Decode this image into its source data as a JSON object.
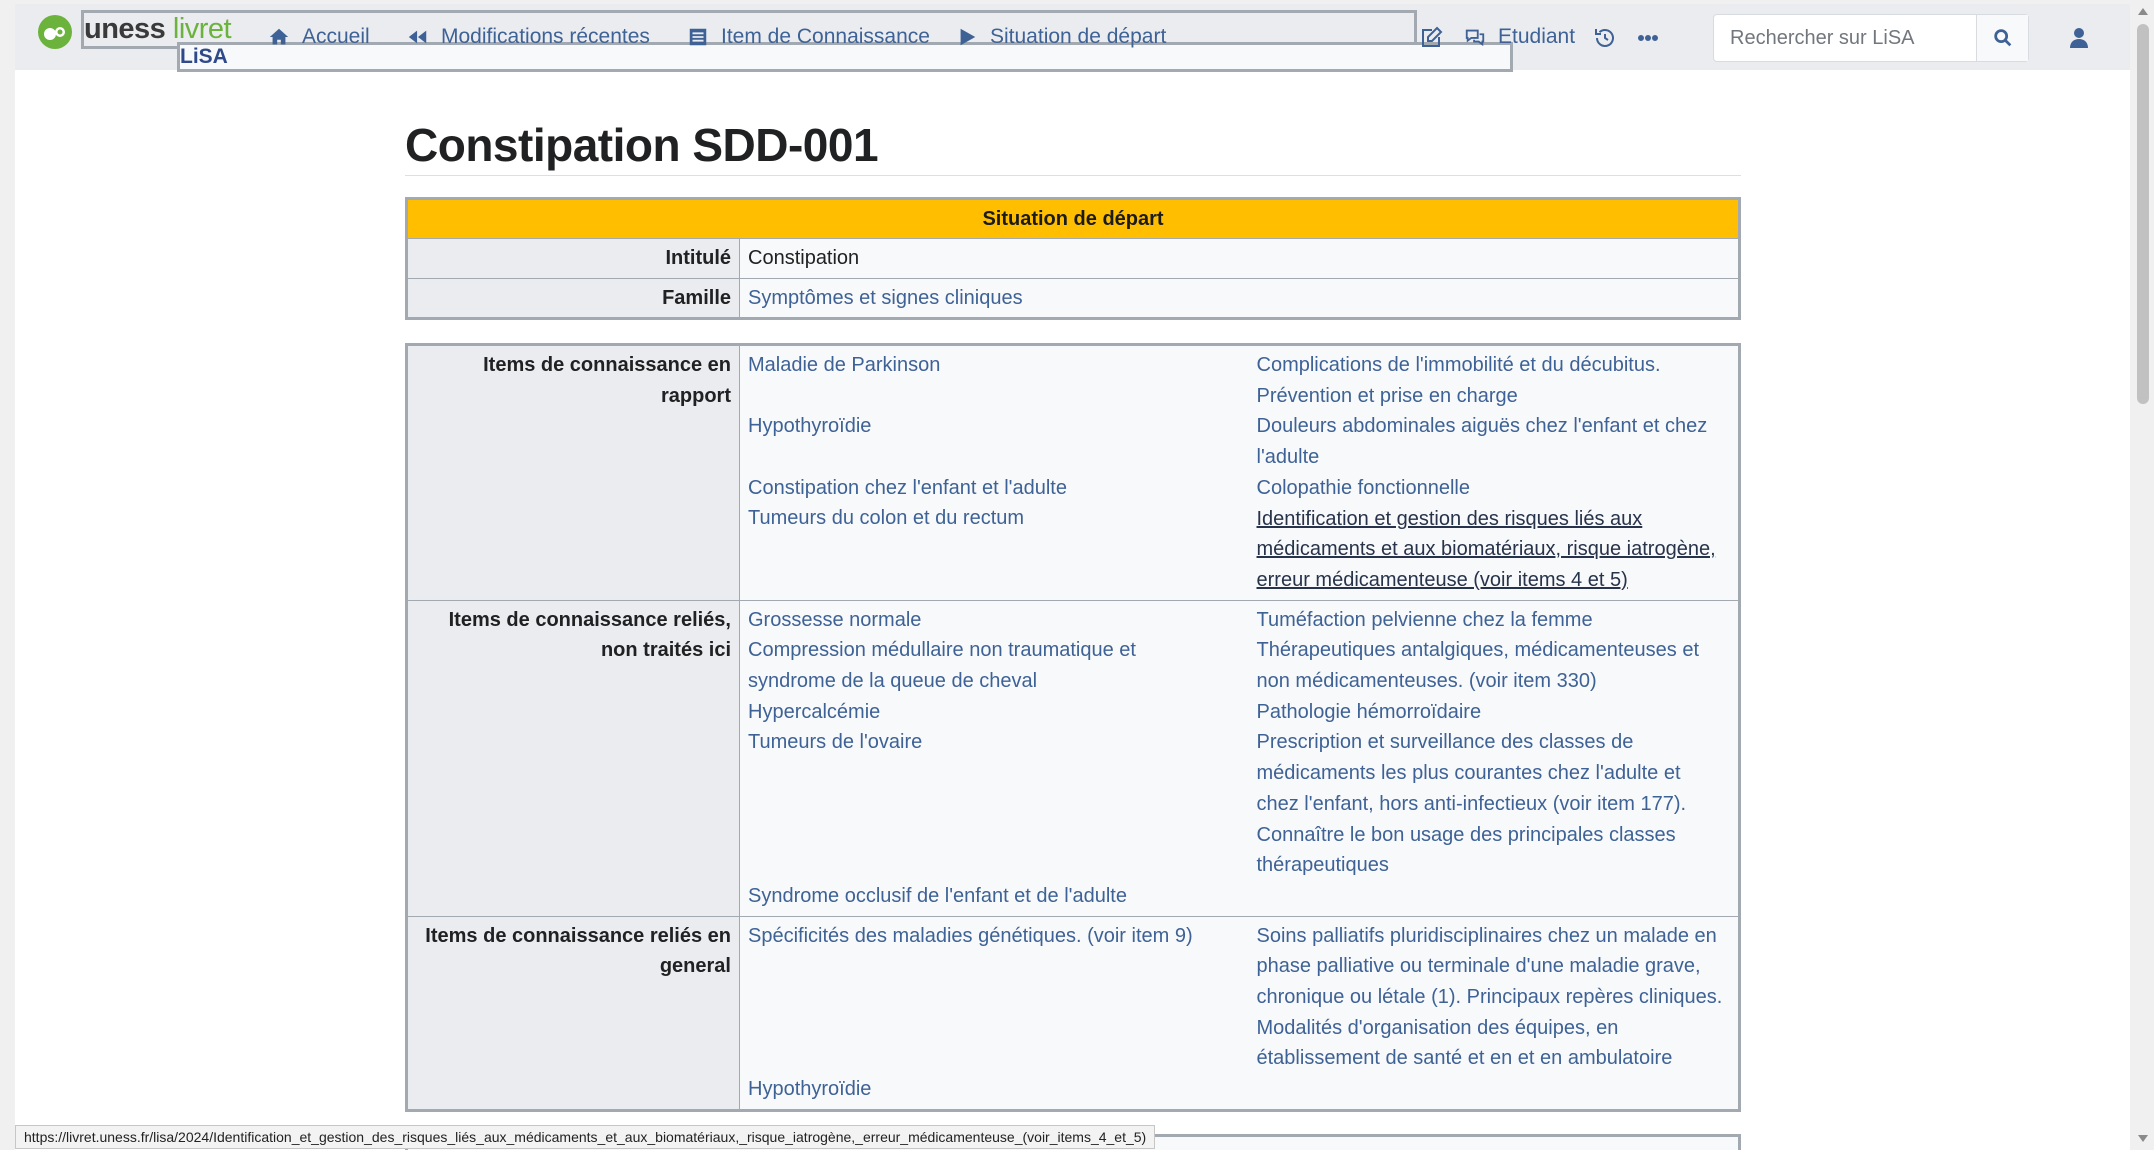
{
  "app": {
    "logo_main": "uness",
    "logo_green": "livret",
    "logo_sub": "LiSA"
  },
  "nav": {
    "home": "Accueil",
    "recent": "Modifications récentes",
    "item": "Item de Connaissance",
    "situation": "Situation de départ",
    "user_role": "Etudiant"
  },
  "search": {
    "placeholder": "Rechercher sur LiSA"
  },
  "page": {
    "title": "Constipation SDD-001"
  },
  "summary_table": {
    "header": "Situation de départ",
    "rows": [
      {
        "label": "Intitulé",
        "value": "Constipation"
      },
      {
        "label": "Famille",
        "value": "Symptômes et signes cliniques"
      }
    ]
  },
  "items_table": {
    "sections": [
      {
        "label_l1": "Items de connaissance en",
        "label_l2": "rapport",
        "left": [
          "Maladie de Parkinson",
          "",
          "Hypothyroïdie",
          "",
          "Constipation chez l'enfant et l'adulte",
          "Tumeurs du colon et du rectum"
        ],
        "right": [
          "Complications de l'immobilité et du décubitus.",
          "Prévention et prise en charge",
          "Douleurs abdominales aiguës chez l'enfant et chez",
          "l'adulte",
          "Colopathie fonctionnelle",
          "Identification et gestion des risques liés aux",
          "médicaments et aux biomatériaux, risque iatrogène,",
          "erreur médicamenteuse (voir items 4 et 5)"
        ]
      },
      {
        "label_l1": "Items de connaissance reliés,",
        "label_l2": "non traités ici",
        "left": [
          "Grossesse normale",
          "Compression médullaire non traumatique et",
          "syndrome de la queue de cheval",
          "Hypercalcémie",
          "Tumeurs de l'ovaire",
          "",
          "",
          "",
          "",
          "Syndrome occlusif de l'enfant et de l'adulte"
        ],
        "right": [
          "Tuméfaction pelvienne chez la femme",
          "Thérapeutiques antalgiques, médicamenteuses et",
          "non médicamenteuses. (voir item 330)",
          "Pathologie hémorroïdaire",
          "Prescription et surveillance des classes de",
          "médicaments les plus courantes chez l'adulte et",
          "chez l'enfant, hors anti-infectieux (voir item 177).",
          "Connaître le bon usage des principales classes",
          "thérapeutiques"
        ]
      },
      {
        "label_l1": "Items de connaissance reliés en",
        "label_l2": "general",
        "left": [
          "Spécificités des maladies génétiques. (voir item 9)",
          "",
          "",
          "",
          "",
          "Hypothyroïdie"
        ],
        "right": [
          "Soins palliatifs pluridisciplinaires chez un malade en",
          "phase palliative ou terminale d'une maladie grave,",
          "chronique ou létale (1). Principaux repères cliniques.",
          "Modalités d'organisation des équipes, en",
          "établissement de santé et en et en ambulatoire"
        ]
      }
    ]
  },
  "status_url": "https://livret.uness.fr/lisa/2024/Identification_et_gestion_des_risques_liés_aux_médicaments_et_aux_biomatériaux,_risque_iatrogène,_erreur_médicamenteuse_(voir_items_4_et_5)",
  "colors": {
    "accent": "#3e6296",
    "header_yellow": "#ffbf00",
    "logo_green": "#6bb33c"
  }
}
